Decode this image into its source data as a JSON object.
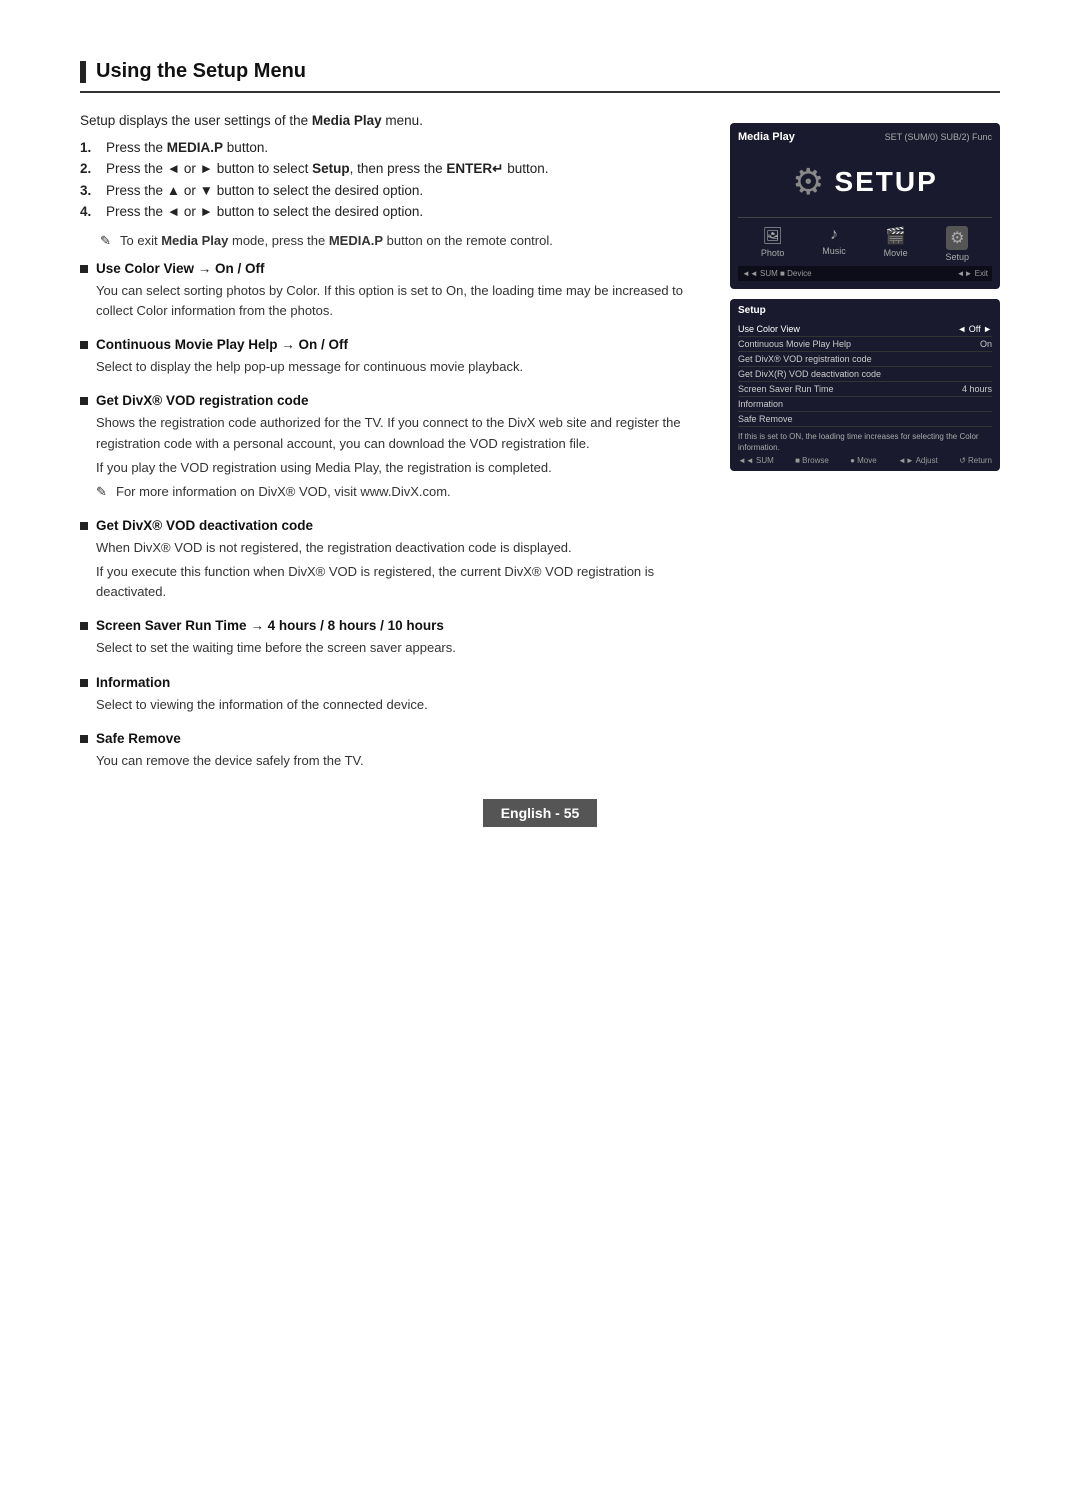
{
  "page": {
    "title": "Using the Setup Menu",
    "footer": "English - 55"
  },
  "intro": "Setup displays the user settings of the Media Play menu.",
  "steps": [
    {
      "num": "1.",
      "text": "Press the MEDIA.P button."
    },
    {
      "num": "2.",
      "text": "Press the ◄ or ► button to select Setup, then press the ENTER↵ button."
    },
    {
      "num": "3.",
      "text": "Press the ▲ or ▼ button to select the desired option."
    },
    {
      "num": "4.",
      "text": "Press the ◄ or ► button to select the desired option."
    }
  ],
  "note_exit": "To exit Media Play mode, press the MEDIA.P button on the remote control.",
  "sections": [
    {
      "id": "use-color-view",
      "title": "Use Color View → On / Off",
      "body": [
        "You can select sorting photos by Color. If this option is set to On, the loading time may be increased to collect Color information from the photos."
      ]
    },
    {
      "id": "continuous-movie",
      "title": "Continuous Movie Play Help → On / Off",
      "body": [
        "Select to display the help pop-up message for continuous movie playback."
      ]
    },
    {
      "id": "divx-registration",
      "title": "Get DivX® VOD registration code",
      "body": [
        "Shows the registration code authorized for the TV. If you connect to the DivX web site and register the registration code with a personal account, you can download the VOD registration file.",
        "If you play the VOD registration using Media Play, the registration is completed.",
        "For more information on DivX® VOD, visit www.DivX.com."
      ]
    },
    {
      "id": "divx-deactivation",
      "title": "Get DivX® VOD deactivation code",
      "body": [
        "When DivX® VOD is not registered, the registration deactivation code is displayed.",
        "If you execute this function when DivX® VOD is registered, the current DivX® VOD registration is deactivated."
      ]
    },
    {
      "id": "screen-saver",
      "title": "Screen Saver Run Time → 4 hours / 8 hours / 10 hours",
      "body": [
        "Select to set the waiting time before the screen saver appears."
      ]
    },
    {
      "id": "information",
      "title": "Information",
      "body": [
        "Select to viewing the information of the connected device."
      ]
    },
    {
      "id": "safe-remove",
      "title": "Safe Remove",
      "body": [
        "You can remove the device safely from the TV."
      ]
    }
  ],
  "screenshot_top": {
    "title": "Media Play",
    "subtitle": "SET (SUM/0) SUB/2) Func",
    "setup_label": "SETUP",
    "icons": [
      {
        "label": "Photo",
        "sym": "🖼"
      },
      {
        "label": "Music",
        "sym": "♪"
      },
      {
        "label": "Movie",
        "sym": "🎬"
      },
      {
        "label": "Setup",
        "sym": "⚙"
      }
    ],
    "bottombar_left": "◄◄ SUM  ■ Device",
    "bottombar_right": "◄► Exit"
  },
  "screenshot_bottom": {
    "title": "Setup",
    "menu_items": [
      {
        "label": "Use Color View",
        "value": "Off",
        "has_arrows": true
      },
      {
        "label": "Continuous Movie Play Help",
        "value": "On",
        "has_arrows": false
      },
      {
        "label": "Get DivX® VOD registration code",
        "value": "",
        "has_arrows": false
      },
      {
        "label": "Get DivX(R) VOD deactivation code",
        "value": "",
        "has_arrows": false
      },
      {
        "label": "Screen Saver Run Time",
        "value": "4 hours",
        "has_arrows": false
      },
      {
        "label": "Information",
        "value": "",
        "has_arrows": false
      },
      {
        "label": "Safe Remove",
        "value": "",
        "has_arrows": false
      }
    ],
    "note": "If this is set to ON, the loading time increases for selecting the Color information.",
    "bottombar": "◄◄ SUM  ■ Browse  ● Move  ◄► Adjust  ↺ Return"
  }
}
